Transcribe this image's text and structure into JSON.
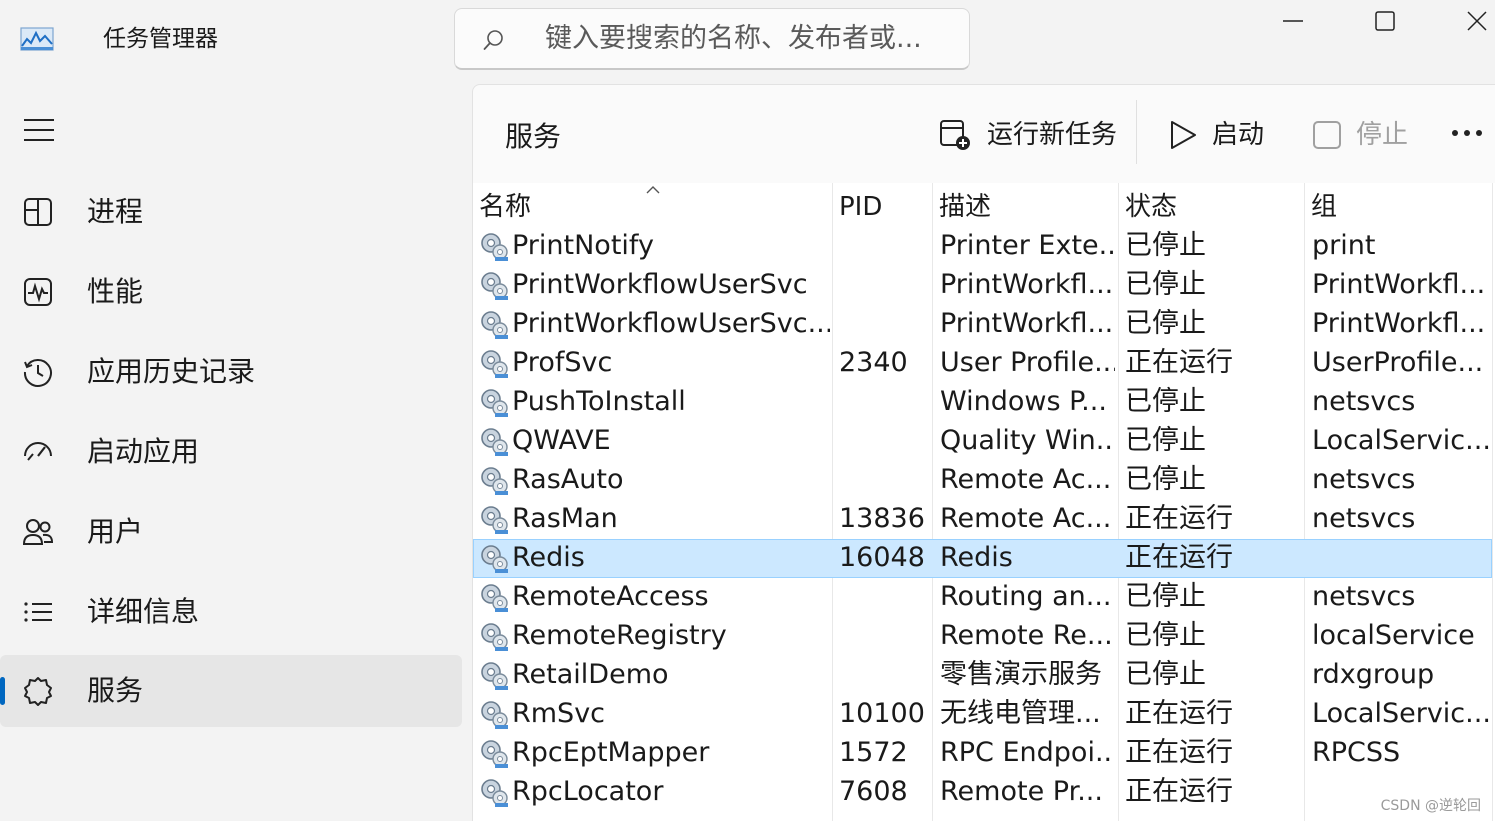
{
  "app": {
    "title": "任务管理器",
    "search_placeholder": "键入要搜索的名称、发布者或..."
  },
  "sidebar": {
    "items": [
      {
        "label": "进程",
        "icon": "processes-icon"
      },
      {
        "label": "性能",
        "icon": "performance-icon"
      },
      {
        "label": "应用历史记录",
        "icon": "app-history-icon"
      },
      {
        "label": "启动应用",
        "icon": "startup-apps-icon"
      },
      {
        "label": "用户",
        "icon": "users-icon"
      },
      {
        "label": "详细信息",
        "icon": "details-icon"
      },
      {
        "label": "服务",
        "icon": "services-icon",
        "active": true
      }
    ]
  },
  "page": {
    "title": "服务",
    "toolbar": {
      "run_new_task": "运行新任务",
      "start": "启动",
      "stop": "停止"
    }
  },
  "table": {
    "columns": [
      "名称",
      "PID",
      "描述",
      "状态",
      "组"
    ],
    "rows": [
      {
        "name": "PrintNotify",
        "pid": "",
        "desc": "Printer Exte...",
        "status": "已停止",
        "group": "print"
      },
      {
        "name": "PrintWorkflowUserSvc",
        "pid": "",
        "desc": "PrintWorkfl...",
        "status": "已停止",
        "group": "PrintWorkfl..."
      },
      {
        "name": "PrintWorkflowUserSvc...",
        "pid": "",
        "desc": "PrintWorkfl...",
        "status": "已停止",
        "group": "PrintWorkfl..."
      },
      {
        "name": "ProfSvc",
        "pid": "2340",
        "desc": "User Profile...",
        "status": "正在运行",
        "group": "UserProfile..."
      },
      {
        "name": "PushToInstall",
        "pid": "",
        "desc": "Windows P...",
        "status": "已停止",
        "group": "netsvcs"
      },
      {
        "name": "QWAVE",
        "pid": "",
        "desc": "Quality Win...",
        "status": "已停止",
        "group": "LocalServic..."
      },
      {
        "name": "RasAuto",
        "pid": "",
        "desc": "Remote Ac...",
        "status": "已停止",
        "group": "netsvcs"
      },
      {
        "name": "RasMan",
        "pid": "13836",
        "desc": "Remote Ac...",
        "status": "正在运行",
        "group": "netsvcs"
      },
      {
        "name": "Redis",
        "pid": "16048",
        "desc": "Redis",
        "status": "正在运行",
        "group": "",
        "selected": true
      },
      {
        "name": "RemoteAccess",
        "pid": "",
        "desc": "Routing an...",
        "status": "已停止",
        "group": "netsvcs"
      },
      {
        "name": "RemoteRegistry",
        "pid": "",
        "desc": "Remote Re...",
        "status": "已停止",
        "group": "localService"
      },
      {
        "name": "RetailDemo",
        "pid": "",
        "desc": "零售演示服务",
        "status": "已停止",
        "group": "rdxgroup"
      },
      {
        "name": "RmSvc",
        "pid": "10100",
        "desc": "无线电管理...",
        "status": "正在运行",
        "group": "LocalServic..."
      },
      {
        "name": "RpcEptMapper",
        "pid": "1572",
        "desc": "RPC Endpoi...",
        "status": "正在运行",
        "group": "RPCSS"
      },
      {
        "name": "RpcLocator",
        "pid": "7608",
        "desc": "Remote Pr...",
        "status": "正在运行",
        "group": ""
      }
    ]
  },
  "watermark": "CSDN @逆轮回",
  "colors": {
    "accent": "#0067c0",
    "selected_row": "#cce8ff",
    "window_bg": "#f3f3f3"
  }
}
